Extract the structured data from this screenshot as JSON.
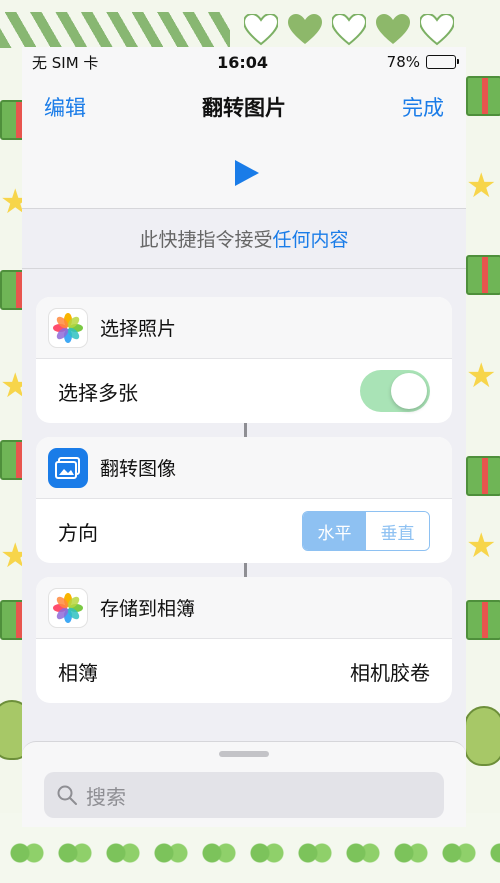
{
  "status_bar": {
    "carrier": "无 SIM 卡",
    "time": "16:04",
    "battery": "78%"
  },
  "nav": {
    "edit_label": "编辑",
    "title": "翻转图片",
    "done_label": "完成"
  },
  "accepts": {
    "prefix": "此快捷指令接受",
    "link": "任何内容"
  },
  "actions": [
    {
      "title": "选择照片",
      "icon": "photos-icon",
      "row_label": "选择多张",
      "toggle_on": true
    },
    {
      "title": "翻转图像",
      "icon": "image-flip-icon",
      "row_label": "方向",
      "segments": [
        "水平",
        "垂直"
      ],
      "selected_segment": "水平"
    },
    {
      "title": "存储到相簿",
      "icon": "photos-icon",
      "row_label": "相簿",
      "value": "相机胶卷"
    }
  ],
  "search": {
    "placeholder": "搜索"
  },
  "colors": {
    "accent": "#1a7ce8",
    "toggle_on": "#a9e3b6",
    "segment_active": "#8ec1f2"
  }
}
